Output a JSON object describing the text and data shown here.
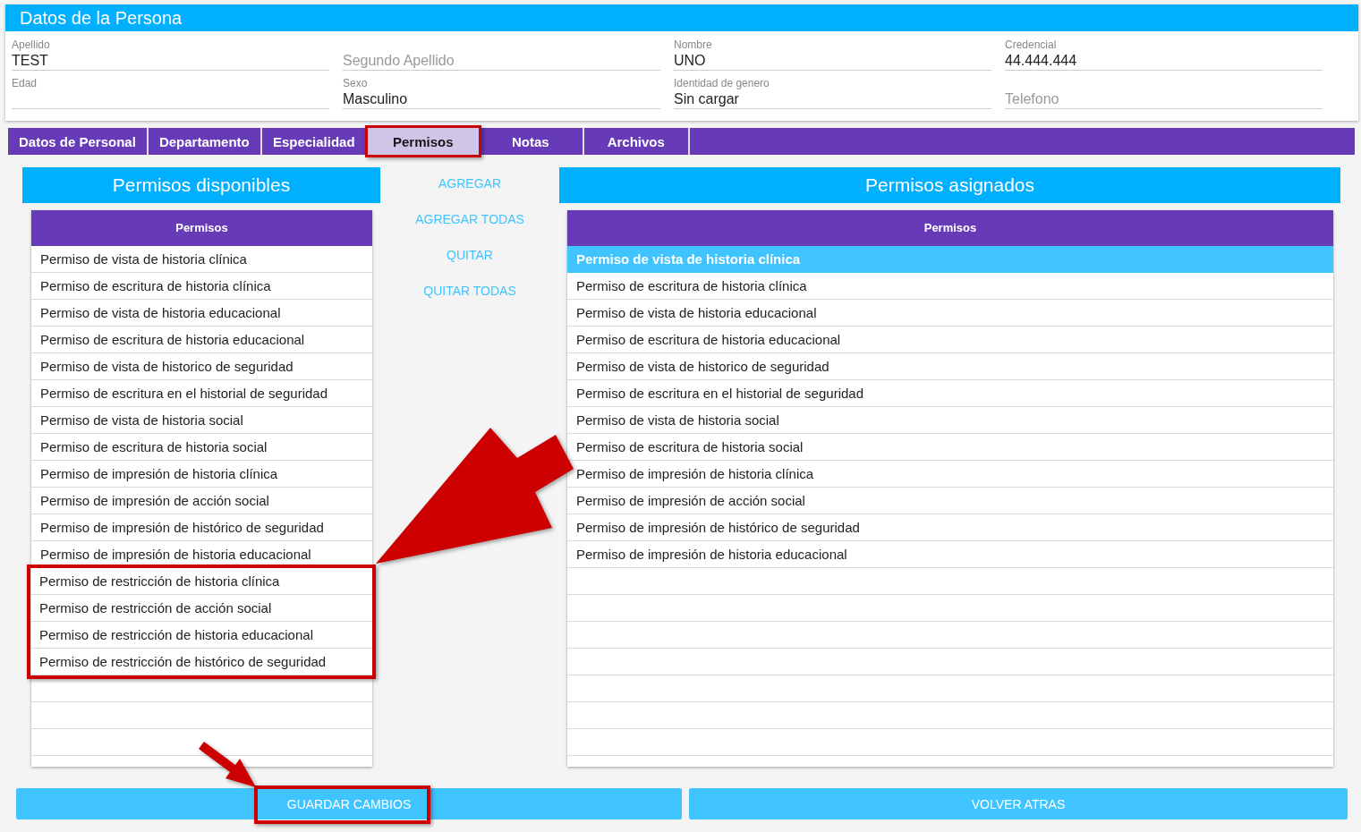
{
  "person": {
    "title": "Datos de la Persona",
    "fields": [
      {
        "label": "Apellido",
        "value": "TEST"
      },
      {
        "placeholder": "Segundo Apellido"
      },
      {
        "label": "Nombre",
        "value": "UNO"
      },
      {
        "label": "Credencial",
        "value": "44.444.444"
      },
      {
        "label": "Edad"
      },
      {
        "label": "Sexo",
        "value": "Masculino"
      },
      {
        "label": "Identidad de genero",
        "value": "Sin cargar"
      },
      {
        "placeholder": "Telefono"
      }
    ]
  },
  "tabs": [
    {
      "label": "Datos de Personal",
      "selected": false,
      "highlighted": false
    },
    {
      "label": "Departamento",
      "selected": false,
      "highlighted": false
    },
    {
      "label": "Especialidad",
      "selected": false,
      "highlighted": false
    },
    {
      "label": "Permisos",
      "selected": true,
      "highlighted": true
    },
    {
      "label": "Notas",
      "selected": false,
      "highlighted": false
    },
    {
      "label": "Archivos",
      "selected": false,
      "highlighted": false
    }
  ],
  "available": {
    "title": "Permisos disponibles",
    "column": "Permisos",
    "rows": [
      {
        "label": "Permiso de vista de historia clínica",
        "selected": false,
        "highlighted": false
      },
      {
        "label": "Permiso de escritura de historia clínica",
        "selected": false,
        "highlighted": false
      },
      {
        "label": "Permiso de vista de historia educacional",
        "selected": false,
        "highlighted": false
      },
      {
        "label": "Permiso de escritura de historia educacional",
        "selected": false,
        "highlighted": false
      },
      {
        "label": "Permiso de vista de historico de seguridad",
        "selected": false,
        "highlighted": false
      },
      {
        "label": "Permiso de escritura en el historial de seguridad",
        "selected": false,
        "highlighted": false
      },
      {
        "label": "Permiso de vista de historia social",
        "selected": false,
        "highlighted": false
      },
      {
        "label": "Permiso de escritura de historia social",
        "selected": false,
        "highlighted": false
      },
      {
        "label": "Permiso de impresión de historia clínica",
        "selected": false,
        "highlighted": false
      },
      {
        "label": "Permiso de impresión de acción social",
        "selected": false,
        "highlighted": false
      },
      {
        "label": "Permiso de impresión de histórico de seguridad",
        "selected": false,
        "highlighted": false
      },
      {
        "label": "Permiso de impresión de historia educacional",
        "selected": false,
        "highlighted": false
      },
      {
        "label": "Permiso de restricción de historia clínica",
        "selected": false,
        "highlighted": true
      },
      {
        "label": "Permiso de restricción de acción social",
        "selected": false,
        "highlighted": true
      },
      {
        "label": "Permiso de restricción de historia educacional",
        "selected": false,
        "highlighted": true
      },
      {
        "label": "Permiso de restricción de histórico de seguridad",
        "selected": false,
        "highlighted": true
      }
    ]
  },
  "actions": [
    "AGREGAR",
    "AGREGAR TODAS",
    "QUITAR",
    "QUITAR TODAS"
  ],
  "assigned": {
    "title": "Permisos asignados",
    "column": "Permisos",
    "rows": [
      {
        "label": "Permiso de vista de historia clínica",
        "selected": true
      },
      {
        "label": "Permiso de escritura de historia clínica",
        "selected": false
      },
      {
        "label": "Permiso de vista de historia educacional",
        "selected": false
      },
      {
        "label": "Permiso de escritura de historia educacional",
        "selected": false
      },
      {
        "label": "Permiso de vista de historico de seguridad",
        "selected": false
      },
      {
        "label": "Permiso de escritura en el historial de seguridad",
        "selected": false
      },
      {
        "label": "Permiso de vista de historia social",
        "selected": false
      },
      {
        "label": "Permiso de escritura de historia social",
        "selected": false
      },
      {
        "label": "Permiso de impresión de historia clínica",
        "selected": false
      },
      {
        "label": "Permiso de impresión de acción social",
        "selected": false
      },
      {
        "label": "Permiso de impresión de histórico de seguridad",
        "selected": false
      },
      {
        "label": "Permiso de impresión de historia educacional",
        "selected": false
      }
    ]
  },
  "buttons": [
    {
      "label": "GUARDAR CAMBIOS",
      "highlighted": true
    },
    {
      "label": "VOLVER ATRAS",
      "highlighted": false
    }
  ],
  "arrows": [
    {
      "kind": "large"
    },
    {
      "kind": "small"
    }
  ]
}
